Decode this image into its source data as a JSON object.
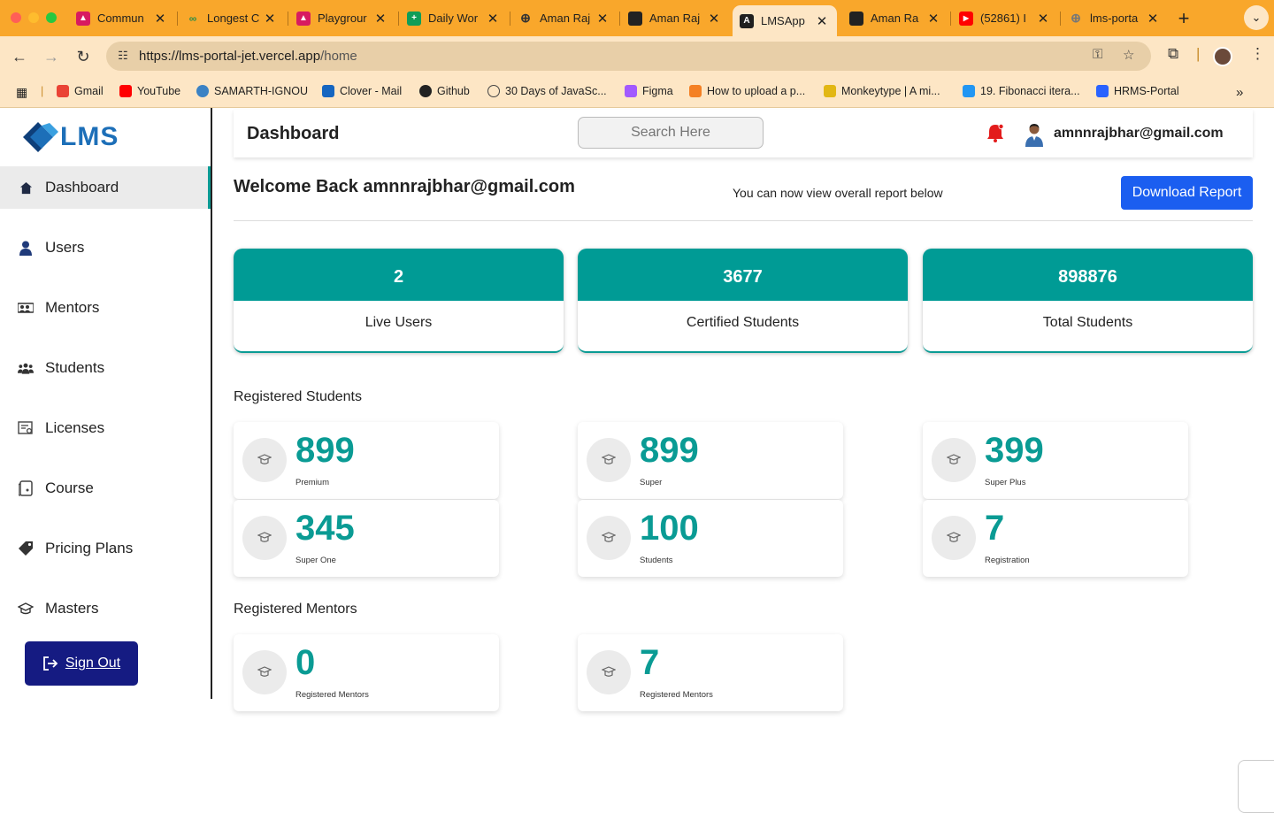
{
  "browser": {
    "tabs": [
      {
        "title": "Commun",
        "color": "#d81b60"
      },
      {
        "title": "Longest C",
        "color": "#2f8d46"
      },
      {
        "title": "Playgrour",
        "color": "#d81b60"
      },
      {
        "title": "Daily Wor",
        "color": "#0f9d58"
      },
      {
        "title": "Aman Raj",
        "color": "#333333"
      },
      {
        "title": "Aman Raj",
        "color": "#222222"
      },
      {
        "title": "LMSApp",
        "color": "#1f1f1f"
      },
      {
        "title": "Aman Ra",
        "color": "#222222"
      },
      {
        "title": "(52861) I",
        "color": "#ff0000"
      },
      {
        "title": "lms-porta",
        "color": "#777777"
      }
    ],
    "url_host": "https://lms-portal-jet.vercel.app",
    "url_path": "/home",
    "bookmarks": [
      {
        "label": "Gmail",
        "color": "#ea4335"
      },
      {
        "label": "YouTube",
        "color": "#ff0000"
      },
      {
        "label": "SAMARTH-IGNOU",
        "color": "#3b82c4"
      },
      {
        "label": "Clover - Mail",
        "color": "#1565c0"
      },
      {
        "label": "Github",
        "color": "#222222"
      },
      {
        "label": "30 Days of JavaSc...",
        "color": "#444444"
      },
      {
        "label": "Figma",
        "color": "#a259ff"
      },
      {
        "label": "How to upload a p...",
        "color": "#f48024"
      },
      {
        "label": "Monkeytype | A mi...",
        "color": "#e2b714"
      },
      {
        "label": "19. Fibonacci itera...",
        "color": "#2196f3"
      },
      {
        "label": "HRMS-Portal",
        "color": "#2962ff"
      }
    ]
  },
  "sidebar": {
    "logo_text": "LMS",
    "items": [
      {
        "label": "Dashboard",
        "icon": "home-icon"
      },
      {
        "label": "Users",
        "icon": "user-icon"
      },
      {
        "label": "Mentors",
        "icon": "mentors-icon"
      },
      {
        "label": "Students",
        "icon": "students-icon"
      },
      {
        "label": "Licenses",
        "icon": "license-icon"
      },
      {
        "label": "Course",
        "icon": "course-icon"
      },
      {
        "label": "Pricing Plans",
        "icon": "tag-icon"
      },
      {
        "label": "Masters",
        "icon": "graduation-cap-icon"
      }
    ],
    "sign_out": "Sign Out"
  },
  "header": {
    "title": "Dashboard",
    "search_placeholder": "Search Here",
    "user_email": "amnnrajbhar@gmail.com"
  },
  "welcome": {
    "text": "Welcome Back amnnrajbhar@gmail.com",
    "report_text": "You can now view overall report below",
    "download_label": "Download Report"
  },
  "stats": [
    {
      "value": "2",
      "label": "Live Users"
    },
    {
      "value": "3677",
      "label": "Certified Students"
    },
    {
      "value": "898876",
      "label": "Total Students"
    }
  ],
  "registered_students": {
    "title": "Registered Students",
    "cards": [
      {
        "value": "899",
        "label": "Premium"
      },
      {
        "value": "899",
        "label": "Super"
      },
      {
        "value": "399",
        "label": "Super Plus"
      },
      {
        "value": "345",
        "label": "Super One"
      },
      {
        "value": "100",
        "label": "Students"
      },
      {
        "value": "7",
        "label": "Registration"
      }
    ]
  },
  "registered_mentors": {
    "title": "Registered Mentors",
    "cards": [
      {
        "value": "0",
        "label": "Registered Mentors"
      },
      {
        "value": "7",
        "label": "Registered Mentors"
      }
    ]
  },
  "colors": {
    "accent": "#009b95",
    "primary_button": "#1b5ef0",
    "sign_out": "#151b82",
    "tabstrip": "#f9a72b"
  }
}
